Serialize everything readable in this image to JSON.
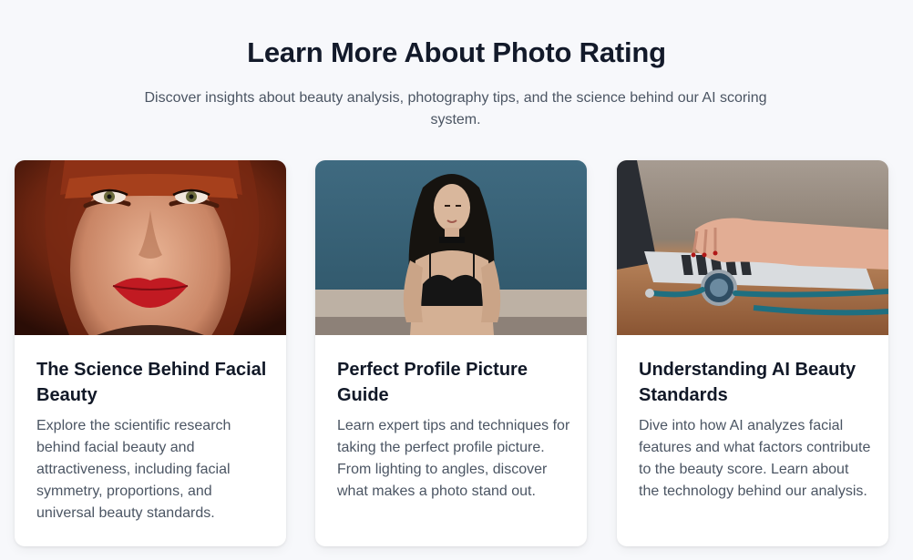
{
  "section": {
    "title": "Learn More About Photo Rating",
    "subtitle": "Discover insights about beauty analysis, photography tips, and the science behind our AI scoring system."
  },
  "cards": [
    {
      "image": "woman-red-hair-portrait",
      "title": "The Science Behind Facial Beauty",
      "description": "Explore the scientific research behind facial beauty and attractiveness, including facial symmetry, proportions, and universal beauty standards."
    },
    {
      "image": "woman-profile-photo-wall",
      "title": "Perfect Profile Picture Guide",
      "description": "Learn expert tips and techniques for taking the perfect profile picture. From lighting to angles, discover what makes a photo stand out."
    },
    {
      "image": "laptop-typing-stethoscope",
      "title": "Understanding AI Beauty Standards",
      "description": "Dive into how AI analyzes facial features and what factors contribute to the beauty score. Learn about the technology behind our analysis."
    }
  ],
  "colors": {
    "background": "#f7f8fb",
    "title": "#131a2a",
    "body_text": "#4b5563",
    "card_bg": "#ffffff"
  }
}
